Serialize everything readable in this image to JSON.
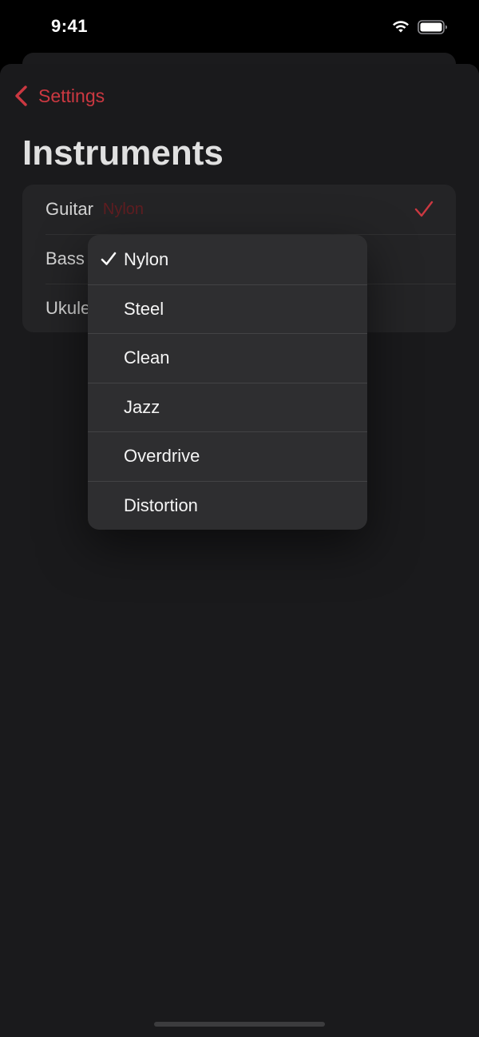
{
  "status_bar": {
    "time": "9:41"
  },
  "icons": {
    "wifi": "wifi-icon",
    "battery": "battery-icon",
    "back": "chevron-left-icon",
    "selected": "checkmark-icon"
  },
  "colors": {
    "accent": "#e8404a",
    "background": "#1e1e20",
    "list_background": "#2a2a2c",
    "menu_background": "#2e2e30"
  },
  "nav": {
    "back_label": "Settings",
    "title": "Instruments"
  },
  "instruments": [
    {
      "label": "Guitar",
      "value": "Nylon",
      "selected": true
    },
    {
      "label": "Bass",
      "value": "",
      "selected": false
    },
    {
      "label": "Ukulele",
      "value": "",
      "selected": false
    }
  ],
  "menu": {
    "selected": "Nylon",
    "options": [
      "Nylon",
      "Steel",
      "Clean",
      "Jazz",
      "Overdrive",
      "Distortion"
    ]
  }
}
